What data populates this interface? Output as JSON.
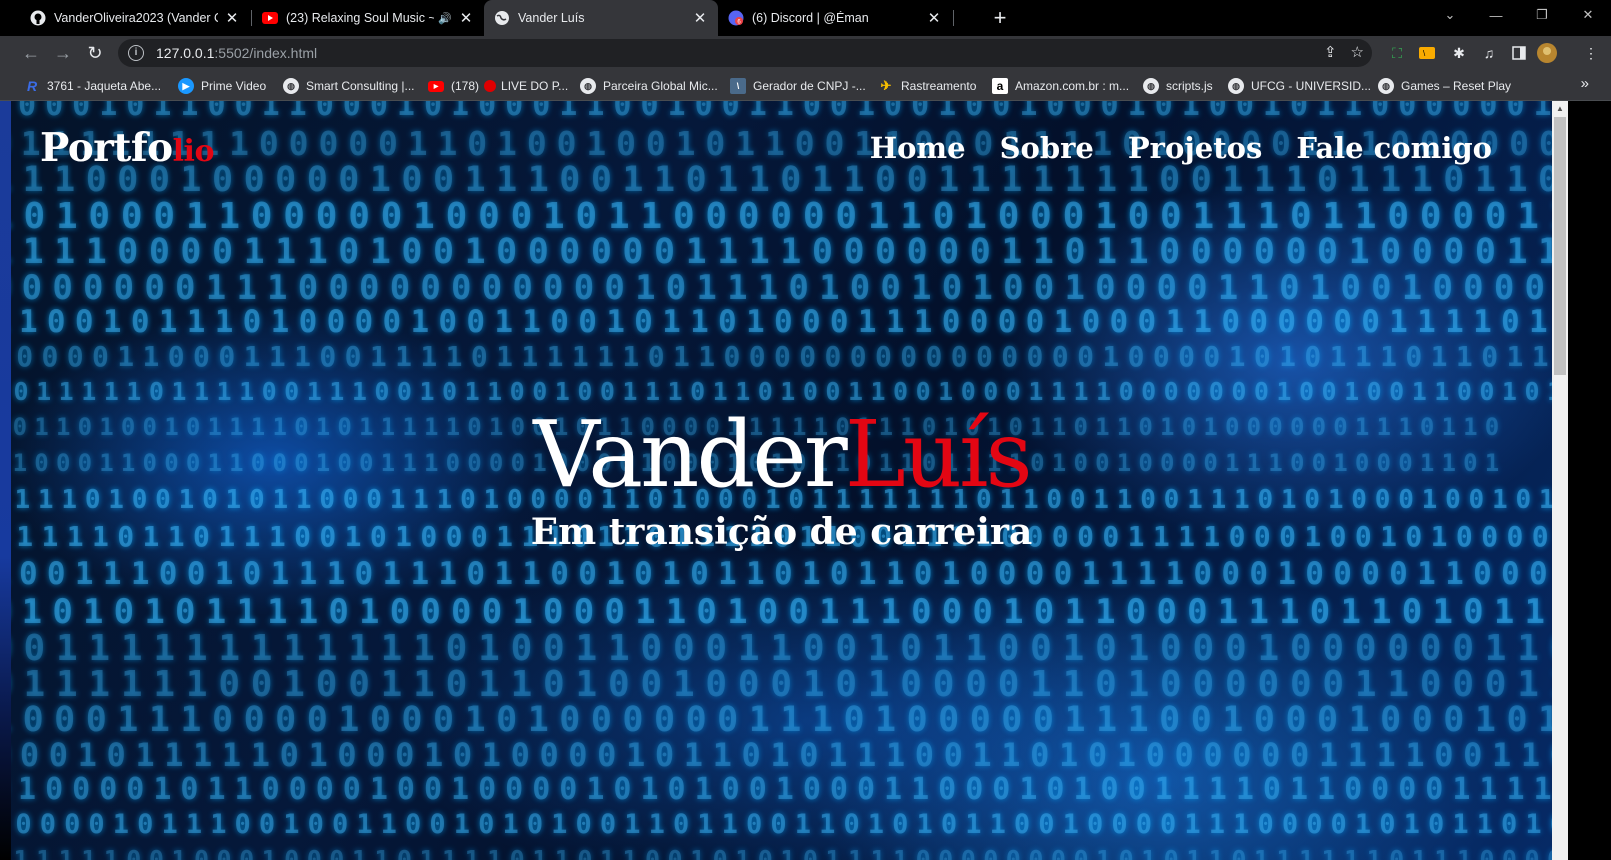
{
  "browser": {
    "tabs": [
      {
        "title": "VanderOliveira2023 (Vander Oliv",
        "icon": "github-icon",
        "active": false
      },
      {
        "title": "(23) Relaxing Soul Music ~ al",
        "icon": "youtube-icon",
        "active": false,
        "audio": true
      },
      {
        "title": "Vander Luís",
        "icon": "globe-icon",
        "active": true
      },
      {
        "title": "(6) Discord | @Éman",
        "icon": "discord-icon",
        "active": false
      }
    ],
    "address": {
      "host": "127.0.0.1",
      "path": ":5502/index.html"
    },
    "bookmarks": [
      {
        "label": "3761 - Jaqueta Abe...",
        "icon": "r-logo-icon"
      },
      {
        "label": "Prime Video",
        "icon": "prime-video-icon"
      },
      {
        "label": "Smart Consulting |...",
        "icon": "globe-icon"
      },
      {
        "label": "(178)",
        "icon": "youtube-icon"
      },
      {
        "label": "LIVE DO P...",
        "icon": "red-dot-icon"
      },
      {
        "label": "Parceira Global Mic...",
        "icon": "globe-icon"
      },
      {
        "label": "Gerador de CNPJ -...",
        "icon": "cnpj-icon"
      },
      {
        "label": "Rastreamento",
        "icon": "tracking-icon"
      },
      {
        "label": "Amazon.com.br : m...",
        "icon": "amazon-icon"
      },
      {
        "label": "scripts.js",
        "icon": "globe-icon"
      },
      {
        "label": "UFCG - UNIVERSID...",
        "icon": "globe-icon"
      },
      {
        "label": "Games – Reset Play",
        "icon": "globe-icon"
      }
    ]
  },
  "site": {
    "logo_main": "Portfo",
    "logo_accent": "lio",
    "nav": [
      "Home",
      "Sobre",
      "Projetos",
      "Fale comigo"
    ],
    "hero_first": "Vander",
    "hero_last": "Luís",
    "hero_subtitle": "Em transição de carreira",
    "accent_color": "#e30613"
  }
}
